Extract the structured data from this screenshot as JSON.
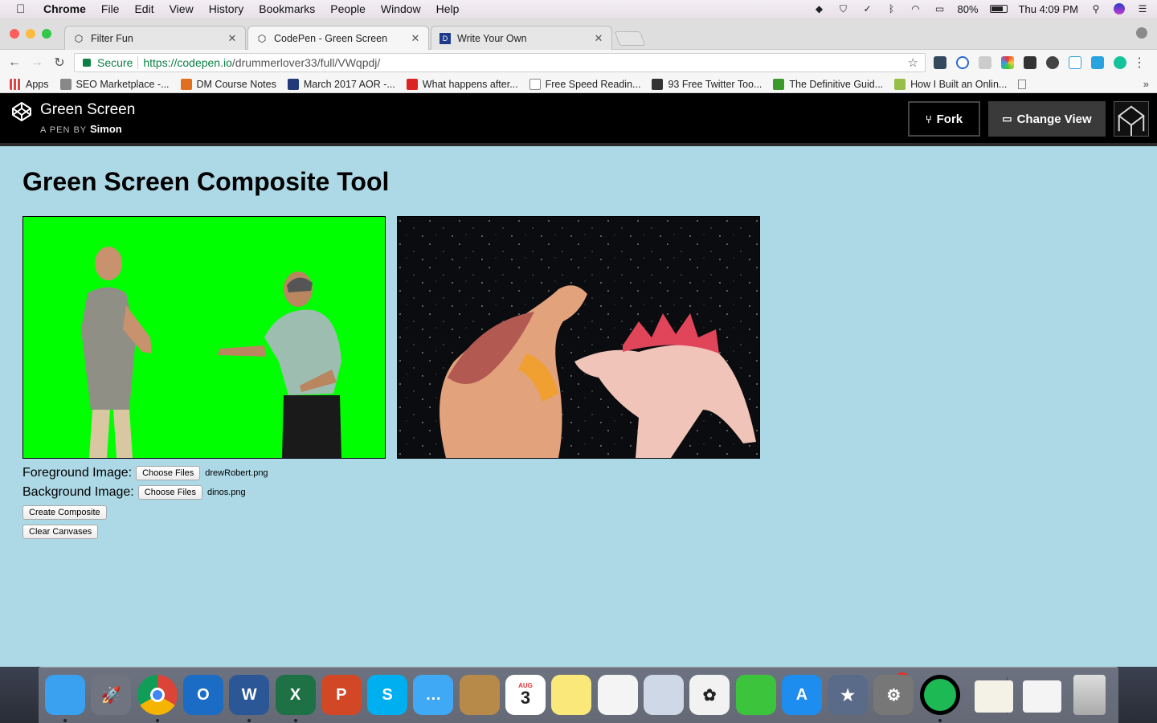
{
  "menubar": {
    "app_name": "Chrome",
    "items": [
      "File",
      "Edit",
      "View",
      "History",
      "Bookmarks",
      "People",
      "Window",
      "Help"
    ],
    "battery": "80%",
    "battery_level": 0.8,
    "clock": "Thu 4:09 PM",
    "tray_icons": [
      "dropbox-icon",
      "shield-icon",
      "check-icon",
      "bluetooth-icon",
      "wifi-icon",
      "airplay-icon"
    ]
  },
  "tabs": [
    {
      "title": "Filter Fun",
      "icon": "codepen-icon",
      "active": false
    },
    {
      "title": "CodePen - Green Screen",
      "icon": "codepen-icon",
      "active": true
    },
    {
      "title": "Write Your Own",
      "icon": "duke-icon",
      "active": false
    }
  ],
  "omnibox": {
    "secure_label": "Secure",
    "url_scheme_host": "https://codepen.io",
    "url_path": "/drummerlover33/full/VWqpdj/"
  },
  "bookmarks": [
    {
      "label": "Apps",
      "color": "#d44"
    },
    {
      "label": "SEO Marketplace -...",
      "color": "#888"
    },
    {
      "label": "DM Course Notes",
      "color": "#e07020"
    },
    {
      "label": "March 2017 AOR -...",
      "color": "#223a7a"
    },
    {
      "label": "What happens after...",
      "color": "#d22"
    },
    {
      "label": "Free Speed Readin...",
      "color": "#fff"
    },
    {
      "label": "93 Free Twitter Too...",
      "color": "#333"
    },
    {
      "label": "The Definitive Guid...",
      "color": "#3a9a2a"
    },
    {
      "label": "How I Built an Onlin...",
      "color": "#95bf47"
    }
  ],
  "codepen": {
    "pen_title": "Green Screen",
    "by_prefix": "A PEN BY",
    "author": "Simon",
    "fork_label": "Fork",
    "change_view_label": "Change View"
  },
  "page": {
    "heading": "Green Screen Composite Tool",
    "foreground_label": "Foreground Image:",
    "background_label": "Background Image:",
    "choose_files_label": "Choose Files",
    "foreground_file": "drewRobert.png",
    "background_file": "dinos.png",
    "create_button": "Create Composite",
    "clear_button": "Clear Canvases"
  },
  "colors": {
    "page_bg": "#add8e6",
    "green_screen": "#00ff00",
    "secure_green": "#0b8043"
  },
  "dock": {
    "items": [
      {
        "name": "finder",
        "color": "#3aa0f0",
        "glyph": ""
      },
      {
        "name": "launchpad",
        "color": "#6f7480",
        "glyph": "🚀"
      },
      {
        "name": "chrome",
        "color": "#e0e0e0",
        "glyph": ""
      },
      {
        "name": "outlook",
        "color": "#1a6cc4",
        "glyph": "O"
      },
      {
        "name": "word",
        "color": "#2b5797",
        "glyph": "W"
      },
      {
        "name": "excel",
        "color": "#1e7145",
        "glyph": "X"
      },
      {
        "name": "powerpoint",
        "color": "#d24726",
        "glyph": "P"
      },
      {
        "name": "skype",
        "color": "#00aff0",
        "glyph": "S"
      },
      {
        "name": "messages",
        "color": "#3fa9f5",
        "glyph": "…"
      },
      {
        "name": "contacts",
        "color": "#b88a4a",
        "glyph": ""
      },
      {
        "name": "calendar",
        "color": "#ffffff",
        "glyph": "3"
      },
      {
        "name": "notes",
        "color": "#fbe87a",
        "glyph": ""
      },
      {
        "name": "reminders",
        "color": "#f4f4f4",
        "glyph": ""
      },
      {
        "name": "preview",
        "color": "#cfd8e6",
        "glyph": ""
      },
      {
        "name": "photos",
        "color": "#f2f2f2",
        "glyph": "✿"
      },
      {
        "name": "facetime",
        "color": "#3cc43c",
        "glyph": ""
      },
      {
        "name": "app-store",
        "color": "#1d8df0",
        "glyph": "A"
      },
      {
        "name": "spark",
        "color": "#5a6b8a",
        "glyph": "★"
      },
      {
        "name": "system-preferences",
        "color": "#777",
        "glyph": "⚙"
      },
      {
        "name": "spotify",
        "color": "#1db954",
        "glyph": ""
      }
    ],
    "badge_value": "1",
    "calendar_month": "AUG"
  }
}
